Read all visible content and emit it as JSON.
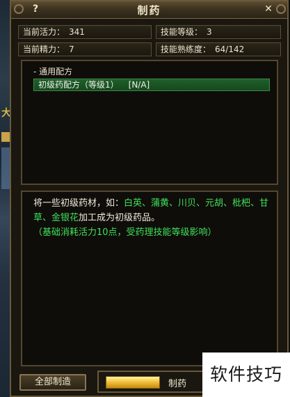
{
  "window": {
    "title": "制药",
    "help_label": "?",
    "close_label": "✕"
  },
  "stats": {
    "vitality_label": "当前活力：",
    "vitality_value": "341",
    "skill_level_label": "技能等级：",
    "skill_level_value": "3",
    "energy_label": "当前精力：",
    "energy_value": "7",
    "proficiency_label": "技能熟练度：",
    "proficiency_value": "64/142"
  },
  "recipes": {
    "group_label": "- 通用配方",
    "items": [
      {
        "name": "初级药配方（等级1）",
        "status": "[N/A]",
        "selected": true
      }
    ]
  },
  "description": {
    "intro": "将一些初级药材，如：",
    "herbs": "白英、蒲黄、川贝、元胡、枇杷、甘草、金银花",
    "outro": "加工成为初级药品。",
    "note": "（基础消耗活力10点，受药理技能等级影响）"
  },
  "actions": {
    "make_all_label": "全部制造",
    "make_label": "制药",
    "progress": 0.28
  },
  "watermark": "软件技巧",
  "colors": {
    "highlight_green": "#3fe05a",
    "selected_row": "#1f5f2a",
    "frame_gold": "#6a5a3a"
  }
}
